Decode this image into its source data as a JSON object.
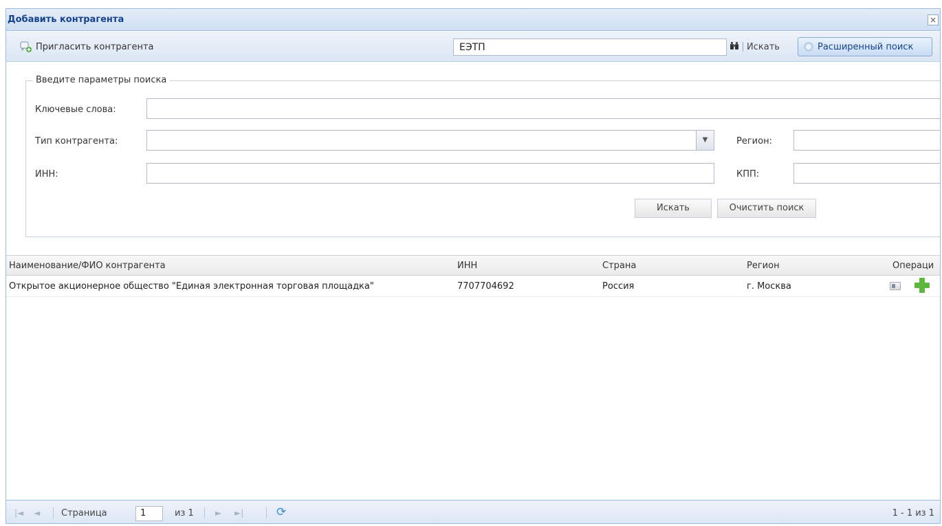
{
  "window": {
    "title": "Добавить контрагента",
    "close_glyph": "×"
  },
  "toolbar": {
    "invite_label": "Пригласить контрагента",
    "quick_search_value": "ЕЭТП",
    "search_label": "Искать",
    "advanced_search_label": "Расширенный поиск"
  },
  "form": {
    "legend": "Введите параметры поиска",
    "keywords_label": "Ключевые слова:",
    "keywords_value": "",
    "type_label": "Тип контрагента:",
    "type_value": "",
    "region_label": "Регион:",
    "region_value": "",
    "inn_label": "ИНН:",
    "inn_value": "",
    "kpp_label": "КПП:",
    "kpp_value": "",
    "search_button": "Искать",
    "clear_button": "Очистить поиск"
  },
  "grid": {
    "columns": [
      "Наименование/ФИО контрагента",
      "ИНН",
      "Страна",
      "Регион",
      "Операци"
    ],
    "rows": [
      {
        "name": "Открытое акционерное общество \"Единая электронная торговая площадка\"",
        "inn": "7707704692",
        "country": "Россия",
        "region": "г. Москва"
      }
    ]
  },
  "pager": {
    "page_label": "Страница",
    "page_value": "1",
    "of_label": "из 1",
    "summary": "1 - 1 из 1"
  },
  "colors": {
    "title_text": "#15428b",
    "header_gradient_top": "#e4edf8",
    "border": "#99bbe8",
    "add_icon": "#5cb83c"
  }
}
